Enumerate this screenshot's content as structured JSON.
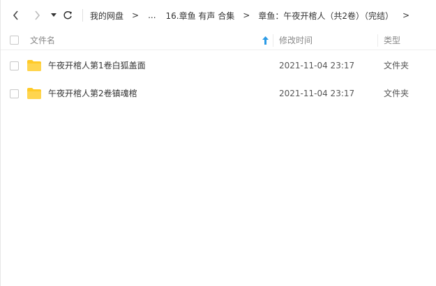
{
  "nav": {
    "back_icon": "chevron-left-icon",
    "forward_icon": "chevron-right-icon",
    "history_icon": "caret-down-icon",
    "refresh_icon": "refresh-icon"
  },
  "breadcrumb": {
    "items": [
      "我的网盘",
      "...",
      "16.章鱼 有声 合集",
      "章鱼：午夜开棺人（共2卷）（完结）"
    ],
    "separator": ">"
  },
  "columns": {
    "name": "文件名",
    "modified": "修改时间",
    "type": "类型",
    "sort_icon": "sort-arrow-up-icon"
  },
  "files": [
    {
      "name": "午夜开棺人第1卷白狐盖面",
      "modified": "2021-11-04 23:17",
      "type": "文件夹",
      "icon": "folder-icon"
    },
    {
      "name": "午夜开棺人第2卷镇魂棺",
      "modified": "2021-11-04 23:17",
      "type": "文件夹",
      "icon": "folder-icon"
    }
  ],
  "colors": {
    "folder": "#FFCA28",
    "sort_arrow": "#2B9BE6",
    "text": "#333333",
    "muted": "#888888"
  }
}
